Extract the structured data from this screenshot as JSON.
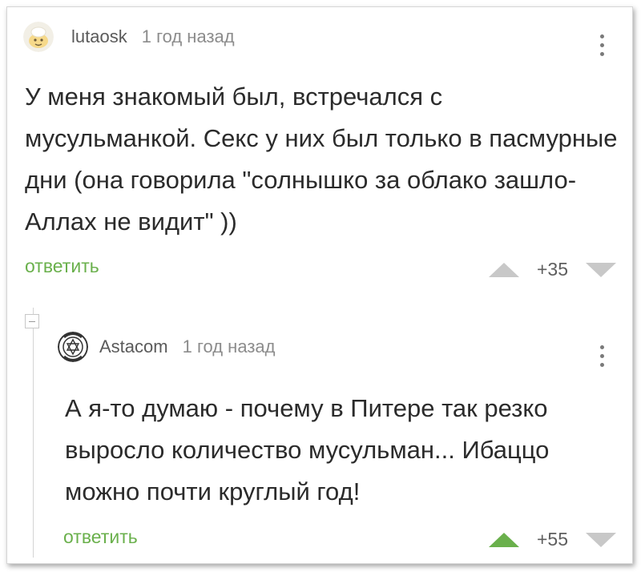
{
  "comments": [
    {
      "author": "lutaosk",
      "time": "1 год назад",
      "text": "У меня знакомый был, встречался с мусульманкой. Секс у них был только в пасмурные дни (она говорила \"солнышко за облако зашло-Аллах не видит\" ))",
      "reply_label": "ответить",
      "score": "+35",
      "upvoted": false
    },
    {
      "author": "Astacom",
      "time": "1 год назад",
      "text": "А я-то думаю - почему в Питере так резко выросло количество мусульман... Ибаццо можно почти круглый год!",
      "reply_label": "ответить",
      "score": "+55",
      "upvoted": true
    }
  ],
  "colors": {
    "accent_green": "#6ab04c",
    "arrow_inactive": "#c8c8c8"
  }
}
